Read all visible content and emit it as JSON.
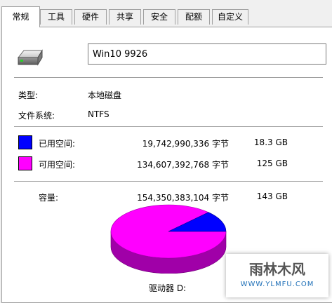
{
  "tabs": [
    {
      "label": "常规",
      "active": true
    },
    {
      "label": "工具"
    },
    {
      "label": "硬件"
    },
    {
      "label": "共享"
    },
    {
      "label": "安全"
    },
    {
      "label": "配额"
    },
    {
      "label": "自定义"
    }
  ],
  "drive": {
    "icon": "hard-drive-icon",
    "name_value": "Win10 9926",
    "type_label": "类型:",
    "type_value": "本地磁盘",
    "fs_label": "文件系统:",
    "fs_value": "NTFS"
  },
  "space": {
    "used": {
      "label": "已用空间:",
      "bytes": "19,742,990,336 字节",
      "size": "18.3 GB",
      "color": "#0000ff"
    },
    "free": {
      "label": "可用空间:",
      "bytes": "134,607,392,768 字节",
      "size": "125 GB",
      "color": "#ff00ff"
    },
    "capacity": {
      "label": "容量:",
      "bytes": "154,350,383,104 字节",
      "size": "143 GB"
    }
  },
  "chart_data": {
    "type": "pie",
    "categories": [
      "已用空间",
      "可用空间"
    ],
    "values": [
      18.3,
      125
    ],
    "colors": [
      "#0000ff",
      "#ff00ff"
    ],
    "title": "驱动器 D:"
  },
  "watermark": {
    "text": "雨林木风",
    "url": "WWW.YLMFU.COM"
  }
}
